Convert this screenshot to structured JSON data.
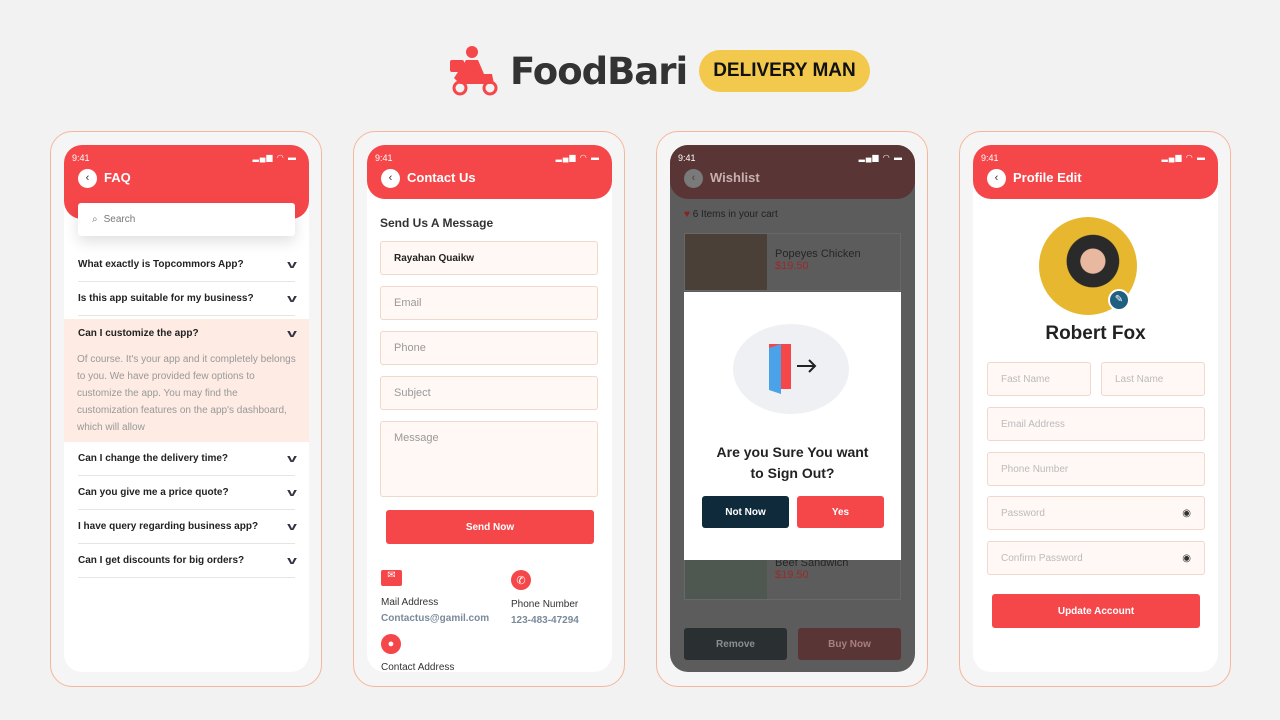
{
  "brand": {
    "name": "FoodBari",
    "badge": "DELIVERY MAN",
    "colors": {
      "primary": "#f5474a",
      "badge": "#f2c94c",
      "dark": "#0f2a3a"
    }
  },
  "status": {
    "time": "9:41",
    "icons": "signal wifi battery"
  },
  "faq": {
    "title": "FAQ",
    "search_placeholder": "Search",
    "items": [
      {
        "q": "What exactly is Topcommors App?"
      },
      {
        "q": "Is this app suitable for my business?"
      },
      {
        "q": "Can I customize the app?",
        "a": "Of course. It's your app and it completely belongs to you. We have provided few options to customize the app. You may find the customization features on the app's dashboard, which will allow",
        "expanded": true
      },
      {
        "q": "Can I change the delivery time?"
      },
      {
        "q": "Can you give me a price quote?"
      },
      {
        "q": "I have query regarding business app?"
      },
      {
        "q": "Can I get discounts for big orders?"
      }
    ]
  },
  "contact": {
    "title": "Contact Us",
    "heading": "Send Us A Message",
    "name_value": "Rayahan Quaikw",
    "email_ph": "Email",
    "phone_ph": "Phone",
    "subject_ph": "Subject",
    "message_ph": "Message",
    "send": "Send Now",
    "mail_label": "Mail Address",
    "mail_value": "Contactus@gamil.com",
    "phone_label": "Phone Number",
    "phone_value": "123-483-47294",
    "address_label": "Contact Address"
  },
  "wishlist": {
    "title": "Wishlist",
    "count": "6 Items in your cart",
    "items": [
      {
        "name": "Popeyes Chicken",
        "price": "$19.50",
        "selected": true
      },
      {
        "name": "Beef Sandwich",
        "price": "$19.50",
        "selected": false
      }
    ],
    "remove": "Remove",
    "buy": "Buy Now",
    "dialog": {
      "question": "Are you Sure You want to Sign Out?",
      "no": "Not Now",
      "yes": "Yes"
    }
  },
  "profile": {
    "title": "Profile Edit",
    "name": "Robert Fox",
    "first_ph": "Fast Name",
    "last_ph": "Last Name",
    "email_ph": "Email Address",
    "phone_ph": "Phone Number",
    "password_ph": "Password",
    "confirm_ph": "Confirm Password",
    "update": "Update Account"
  }
}
